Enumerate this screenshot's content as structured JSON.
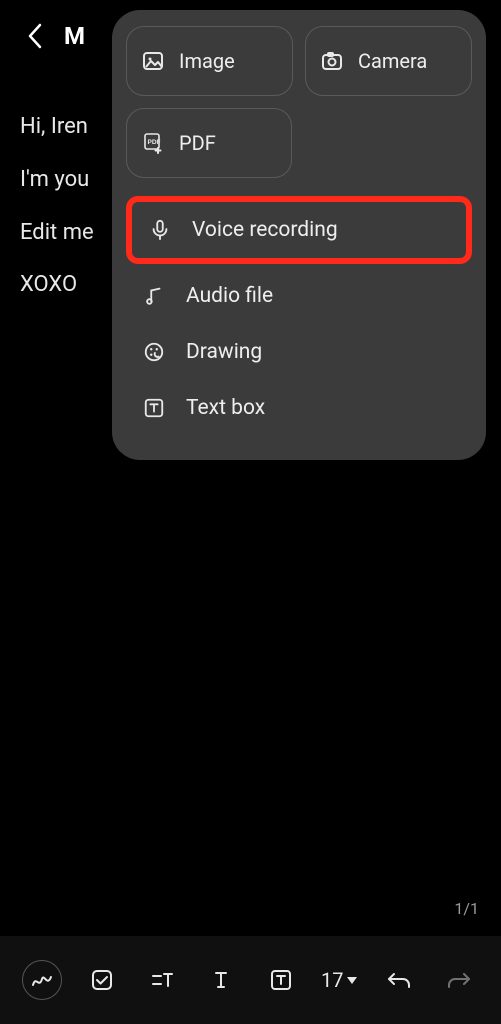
{
  "header": {
    "title": "M"
  },
  "note": {
    "line1": "Hi, Iren",
    "line2": "I'm you",
    "line3": "Edit me",
    "line4": "XOXO"
  },
  "page_indicator": "1/1",
  "toolbar": {
    "font_size": "17"
  },
  "popup": {
    "top": {
      "image": "Image",
      "camera": "Camera",
      "pdf": "PDF"
    },
    "items": {
      "voice": "Voice recording",
      "audio": "Audio file",
      "drawing": "Drawing",
      "textbox": "Text box"
    }
  }
}
